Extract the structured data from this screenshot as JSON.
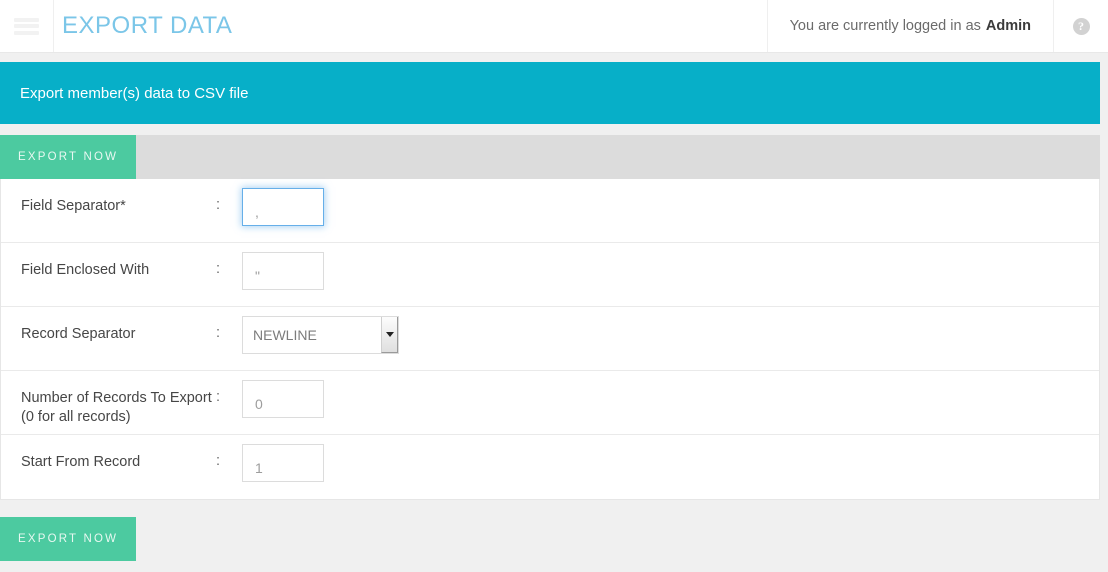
{
  "topbar": {
    "menu_icon": "hamburger-icon",
    "title": "EXPORT DATA",
    "login_prefix": "You are currently logged in as",
    "username": "Admin",
    "help_icon": "question-mark-icon",
    "help_glyph": "?",
    "title_color": "#7bc6e8"
  },
  "panel": {
    "heading": "Export member(s) data to CSV file",
    "heading_bg": "#07afc8"
  },
  "toolbar": {
    "export_label": "EXPORT NOW",
    "button_color": "#4ccaa0",
    "bar_color": "#dcdcdc"
  },
  "form": {
    "colon": ":",
    "rows": [
      {
        "label": "Field Separator*",
        "type": "text",
        "value": ",",
        "focused": true,
        "name": "field-separator"
      },
      {
        "label": "Field Enclosed With",
        "type": "text",
        "value": "\"",
        "focused": false,
        "name": "field-enclosed-with"
      },
      {
        "label": "Record Separator",
        "type": "select",
        "value": "NEWLINE",
        "options": [
          "NEWLINE"
        ],
        "focused": false,
        "name": "record-separator"
      },
      {
        "label": "Number of Records To Export (0 for all records)",
        "type": "text",
        "value": "0",
        "focused": false,
        "name": "number-of-records"
      },
      {
        "label": "Start From Record",
        "type": "text",
        "value": "1",
        "focused": false,
        "name": "start-from-record"
      }
    ]
  },
  "footer": {
    "export_label": "EXPORT NOW"
  }
}
